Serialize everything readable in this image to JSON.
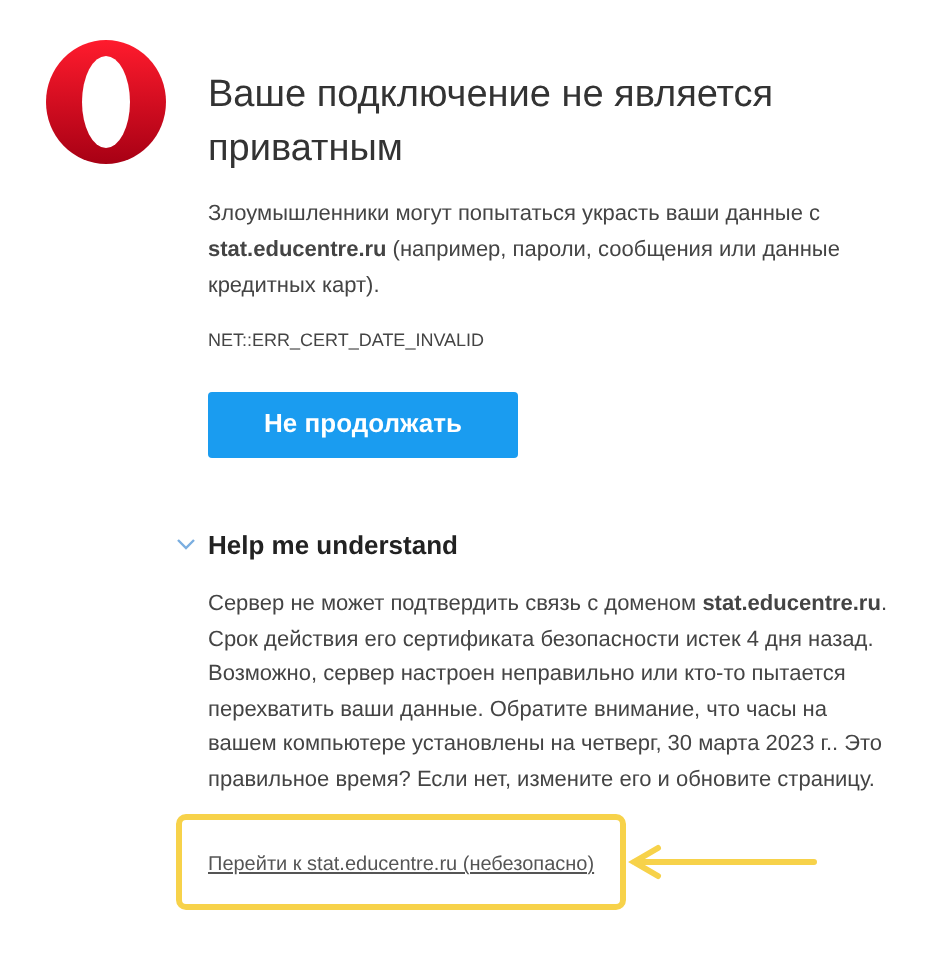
{
  "title": "Ваше подключение не является приватным",
  "warning": "Злоумышленники могут попытаться украсть ваши данные с **stat.educentre.ru** (например, пароли, сообщения или данные кредитных карт).",
  "error_code": "NET::ERR_CERT_DATE_INVALID",
  "back_button": "Не продолжать",
  "details": {
    "heading": "Help me understand",
    "expanded": true,
    "text": "Сервер не может подтвердить связь с доменом **stat.educentre.ru**. Срок действия его сертификата безопасности истек 4 дня назад. Возможно, сервер настроен неправильно или кто-то пытается перехватить ваши данные. Обратите внимание, что часы на вашем компьютере установлены на четверг, 30 марта 2023 г.. Это правильное время? Если нет, измените его и обновите страницу.",
    "proceed_link": "Перейти к stat.educentre.ru (небезопасно)"
  }
}
